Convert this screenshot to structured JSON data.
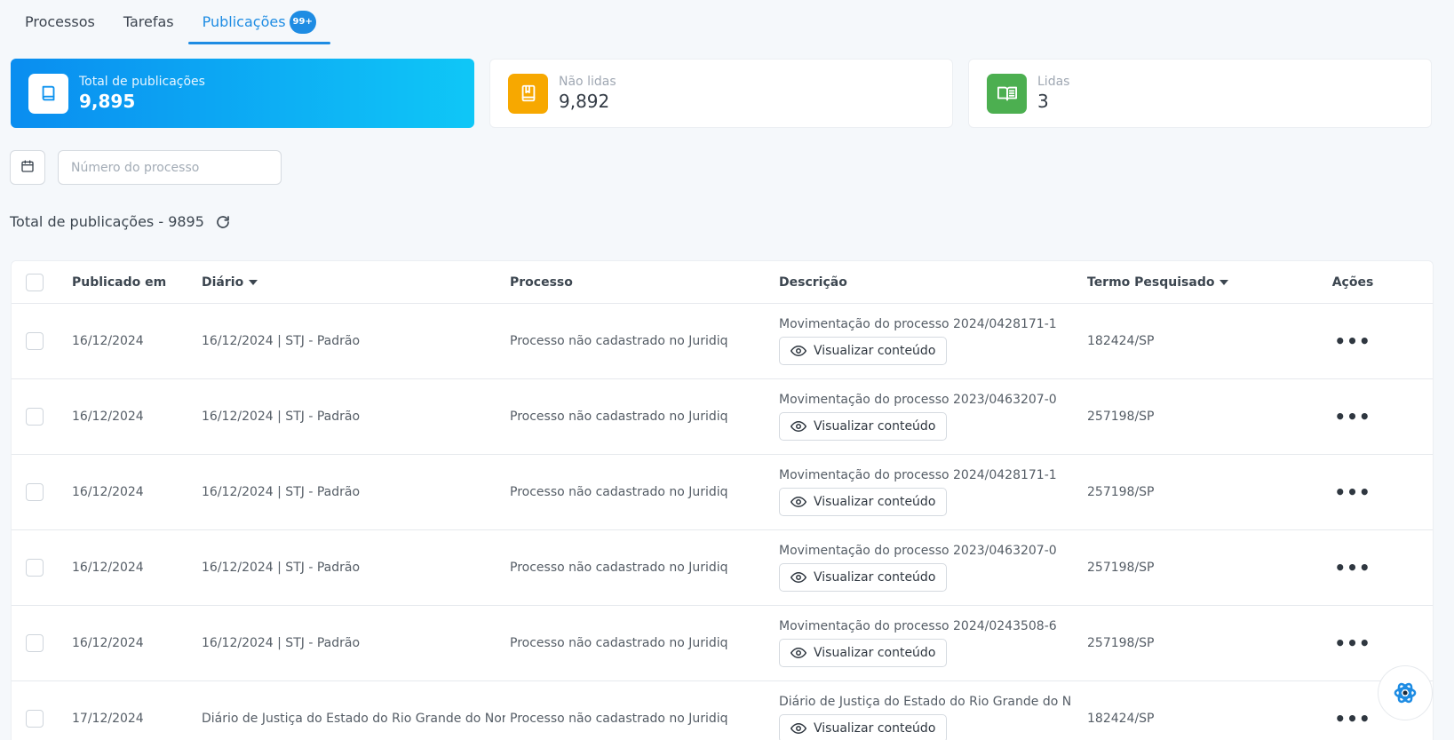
{
  "tabs": [
    {
      "label": "Processos"
    },
    {
      "label": "Tarefas"
    },
    {
      "label": "Publicações",
      "badge": "99+"
    }
  ],
  "stats": {
    "total": {
      "label": "Total de publicações",
      "value": "9,895",
      "icon": "book-icon"
    },
    "unread": {
      "label": "Não lidas",
      "value": "9,892",
      "icon": "bookmark-book-icon",
      "color": "#f7a800"
    },
    "read": {
      "label": "Lidas",
      "value": "3",
      "icon": "open-book-icon",
      "color": "#4caf50"
    }
  },
  "filters": {
    "calendar_icon": "calendar-icon",
    "process_placeholder": "Número do processo"
  },
  "summary": {
    "text": "Total de publicações - 9895",
    "refresh_icon": "refresh-icon"
  },
  "table": {
    "headers": {
      "published": "Publicado em",
      "diary": "Diário",
      "process": "Processo",
      "description": "Descrição",
      "term": "Termo Pesquisado",
      "actions": "Ações"
    },
    "view_label": "Visualizar conteúdo",
    "rows": [
      {
        "published": "16/12/2024",
        "diary": "16/12/2024 | STJ - Padrão",
        "process": "Processo não cadastrado no Juridiq",
        "description": "Movimentação do processo 2024/0428171-1",
        "term": "182424/SP"
      },
      {
        "published": "16/12/2024",
        "diary": "16/12/2024 | STJ - Padrão",
        "process": "Processo não cadastrado no Juridiq",
        "description": "Movimentação do processo 2023/0463207-0",
        "term": "257198/SP"
      },
      {
        "published": "16/12/2024",
        "diary": "16/12/2024 | STJ - Padrão",
        "process": "Processo não cadastrado no Juridiq",
        "description": "Movimentação do processo 2024/0428171-1",
        "term": "257198/SP"
      },
      {
        "published": "16/12/2024",
        "diary": "16/12/2024 | STJ - Padrão",
        "process": "Processo não cadastrado no Juridiq",
        "description": "Movimentação do processo 2023/0463207-0",
        "term": "257198/SP"
      },
      {
        "published": "16/12/2024",
        "diary": "16/12/2024 | STJ - Padrão",
        "process": "Processo não cadastrado no Juridiq",
        "description": "Movimentação do processo 2024/0243508-6",
        "term": "257198/SP"
      },
      {
        "published": "17/12/2024",
        "diary": "Diário de Justiça do Estado do Rio Grande do Norte",
        "process": "Processo não cadastrado no Juridiq",
        "description": "Diário de Justiça do Estado do Rio Grande do Norte",
        "term": "182424/SP"
      }
    ],
    "actions_icon": "more-horizontal-icon"
  },
  "assistant": {
    "icon": "assistant-logo-icon"
  },
  "colors": {
    "accent": "#1e8ce3",
    "warning": "#f7a800",
    "success": "#4caf50"
  }
}
